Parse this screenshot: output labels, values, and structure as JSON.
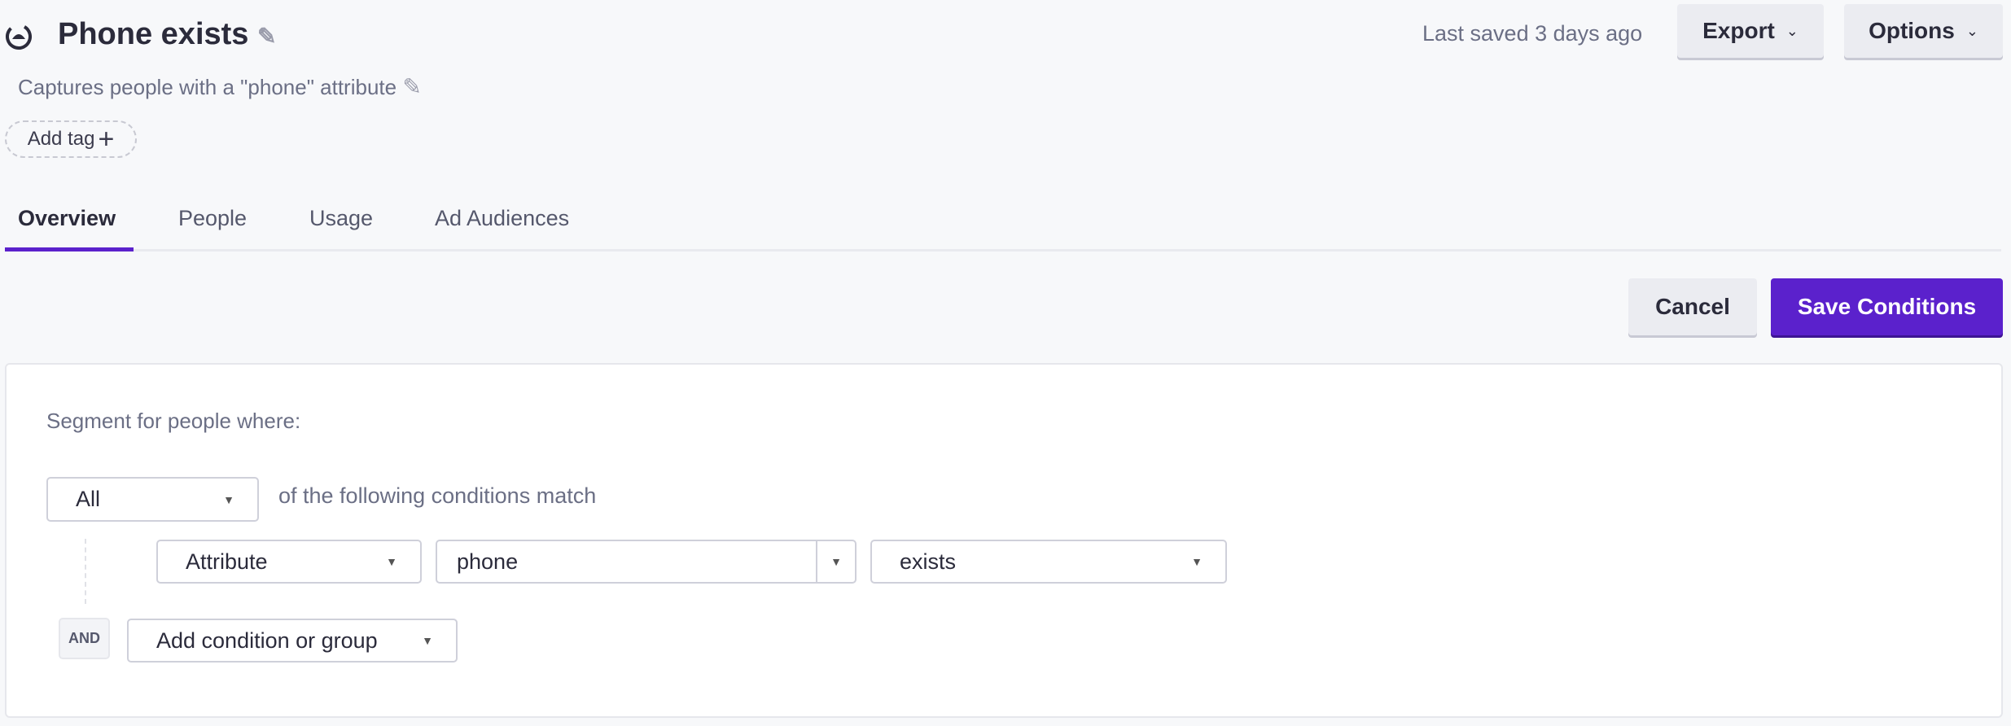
{
  "header": {
    "title": "Phone exists",
    "description": "Captures people with a \"phone\" attribute",
    "add_tag": "Add tag",
    "last_saved": "Last saved 3 days ago",
    "export": "Export",
    "options": "Options"
  },
  "tabs": [
    {
      "label": "Overview",
      "active": true
    },
    {
      "label": "People"
    },
    {
      "label": "Usage"
    },
    {
      "label": "Ad Audiences"
    }
  ],
  "actions": {
    "cancel": "Cancel",
    "save": "Save Conditions"
  },
  "colors": {
    "accent": "#5b21cc"
  },
  "segment": {
    "intro": "Segment for people where:",
    "match_select": "All",
    "match_text": "of the following conditions match",
    "condition": {
      "type": "Attribute",
      "attribute": "phone",
      "operator": "exists"
    },
    "and_label": "AND",
    "add_condition": "Add condition or group"
  }
}
